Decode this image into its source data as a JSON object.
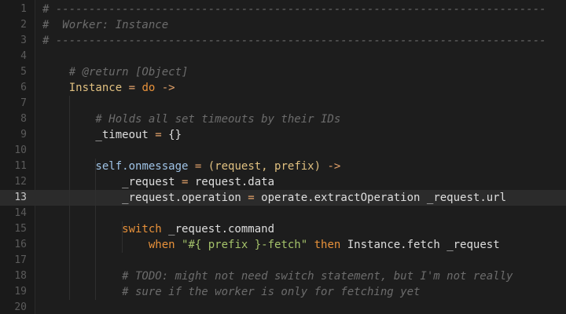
{
  "colors": {
    "background": "#1d1d1d",
    "active_line": "#2b2b2b",
    "comment": "#6c6c6c",
    "keyword": "#e8913a",
    "string": "#a4c26a"
  },
  "editor": {
    "active_line": 13,
    "lines": [
      {
        "num": "1",
        "tokens": [
          {
            "t": "# ",
            "c": "c-hash"
          },
          {
            "t": "--------------------------------------------------------------------------",
            "c": "c-comment"
          }
        ]
      },
      {
        "num": "2",
        "tokens": [
          {
            "t": "#  Worker: Instance",
            "c": "c-comment"
          }
        ]
      },
      {
        "num": "3",
        "tokens": [
          {
            "t": "# ",
            "c": "c-hash"
          },
          {
            "t": "--------------------------------------------------------------------------",
            "c": "c-comment"
          }
        ]
      },
      {
        "num": "4",
        "tokens": []
      },
      {
        "num": "5",
        "tokens": [
          {
            "t": "    # @return [Object]",
            "c": "c-comment"
          }
        ]
      },
      {
        "num": "6",
        "tokens": [
          {
            "t": "    Instance",
            "c": "c-var"
          },
          {
            "t": " = ",
            "c": "c-op"
          },
          {
            "t": "do",
            "c": "c-key"
          },
          {
            "t": " ->",
            "c": "c-op"
          }
        ]
      },
      {
        "num": "7",
        "tokens": []
      },
      {
        "num": "8",
        "tokens": [
          {
            "t": "        # Holds all set timeouts by their IDs",
            "c": "c-comment"
          }
        ]
      },
      {
        "num": "9",
        "tokens": [
          {
            "t": "        _timeout",
            "c": "c-plain"
          },
          {
            "t": " = ",
            "c": "c-op"
          },
          {
            "t": "{}",
            "c": "c-plain"
          }
        ]
      },
      {
        "num": "10",
        "tokens": []
      },
      {
        "num": "11",
        "tokens": [
          {
            "t": "        self",
            "c": "c-self"
          },
          {
            "t": ".onmessage",
            "c": "c-self"
          },
          {
            "t": " = ",
            "c": "c-op"
          },
          {
            "t": "(request, prefix)",
            "c": "c-var"
          },
          {
            "t": " ->",
            "c": "c-op"
          }
        ]
      },
      {
        "num": "12",
        "tokens": [
          {
            "t": "            _request",
            "c": "c-plain"
          },
          {
            "t": " = ",
            "c": "c-op"
          },
          {
            "t": "request.data",
            "c": "c-plain"
          }
        ]
      },
      {
        "num": "13",
        "tokens": [
          {
            "t": "            _request.operation",
            "c": "c-plain"
          },
          {
            "t": " = ",
            "c": "c-op"
          },
          {
            "t": "operate.extractOperation _request.url",
            "c": "c-plain"
          }
        ]
      },
      {
        "num": "14",
        "tokens": []
      },
      {
        "num": "15",
        "tokens": [
          {
            "t": "            switch",
            "c": "c-key"
          },
          {
            "t": " _request.command",
            "c": "c-plain"
          }
        ]
      },
      {
        "num": "16",
        "tokens": [
          {
            "t": "                when",
            "c": "c-key"
          },
          {
            "t": " \"",
            "c": "c-str"
          },
          {
            "t": "#{ prefix }",
            "c": "c-str"
          },
          {
            "t": "-fetch\"",
            "c": "c-str"
          },
          {
            "t": " then",
            "c": "c-key"
          },
          {
            "t": " Instance.fetch _request",
            "c": "c-plain"
          }
        ]
      },
      {
        "num": "17",
        "tokens": []
      },
      {
        "num": "18",
        "tokens": [
          {
            "t": "            # TODO: might not need switch statement, but I'm not really",
            "c": "c-comment"
          }
        ]
      },
      {
        "num": "19",
        "tokens": [
          {
            "t": "            # sure if the worker is only for fetching yet",
            "c": "c-comment"
          }
        ]
      },
      {
        "num": "20",
        "tokens": []
      }
    ]
  }
}
